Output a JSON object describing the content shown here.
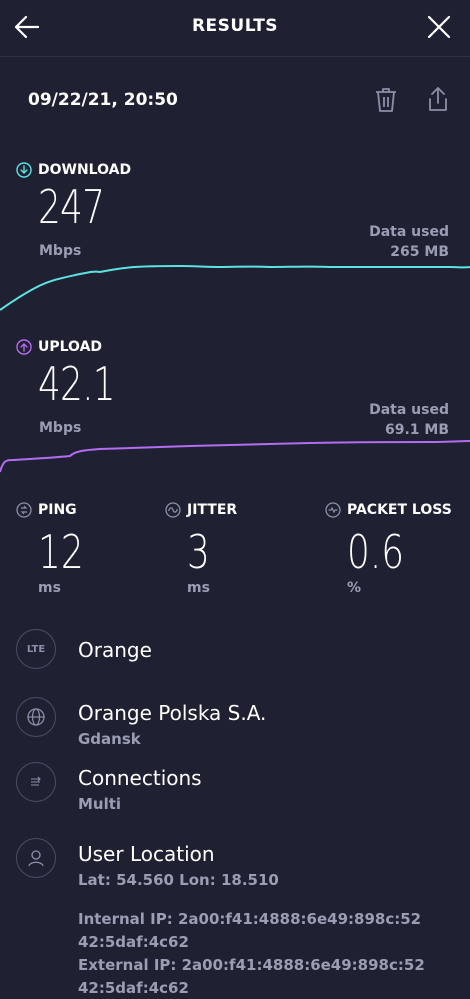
{
  "header": {
    "title": "RESULTS"
  },
  "result": {
    "datetime": "09/22/21, 20:50"
  },
  "download": {
    "label": "DOWNLOAD",
    "value": "247",
    "unit": "Mbps",
    "data_used_label": "Data used",
    "data_used_value": "265 MB",
    "color": "#5ee3e0"
  },
  "upload": {
    "label": "UPLOAD",
    "value": "42.1",
    "unit": "Mbps",
    "data_used_label": "Data used",
    "data_used_value": "69.1 MB",
    "color": "#b46cf0"
  },
  "metrics": {
    "ping": {
      "label": "PING",
      "value": "12",
      "unit": "ms"
    },
    "jitter": {
      "label": "JITTER",
      "value": "3",
      "unit": "ms"
    },
    "packet_loss": {
      "label": "PACKET LOSS",
      "value": "0.6",
      "unit": "%"
    }
  },
  "info": {
    "carrier": {
      "icon_text": "LTE",
      "name": "Orange"
    },
    "provider": {
      "name": "Orange Polska S.A.",
      "city": "Gdansk"
    },
    "connections": {
      "label": "Connections",
      "value": "Multi"
    },
    "location": {
      "label": "User Location",
      "coords": "Lat: 54.560 Lon: 18.510"
    }
  },
  "ip": {
    "internal_line1": "Internal IP: 2a00:f41:4888:6e49:898c:52",
    "internal_line2": "42:5daf:4c62",
    "external_line1": "External IP: 2a00:f41:4888:6e49:898c:52",
    "external_line2": "42:5daf:4c62"
  },
  "icons": [
    "back-arrow-icon",
    "close-icon",
    "trash-icon",
    "share-icon",
    "download-arrow-icon",
    "upload-arrow-icon",
    "ping-icon",
    "jitter-icon",
    "packet-loss-icon",
    "globe-icon",
    "connections-icon",
    "user-icon"
  ]
}
